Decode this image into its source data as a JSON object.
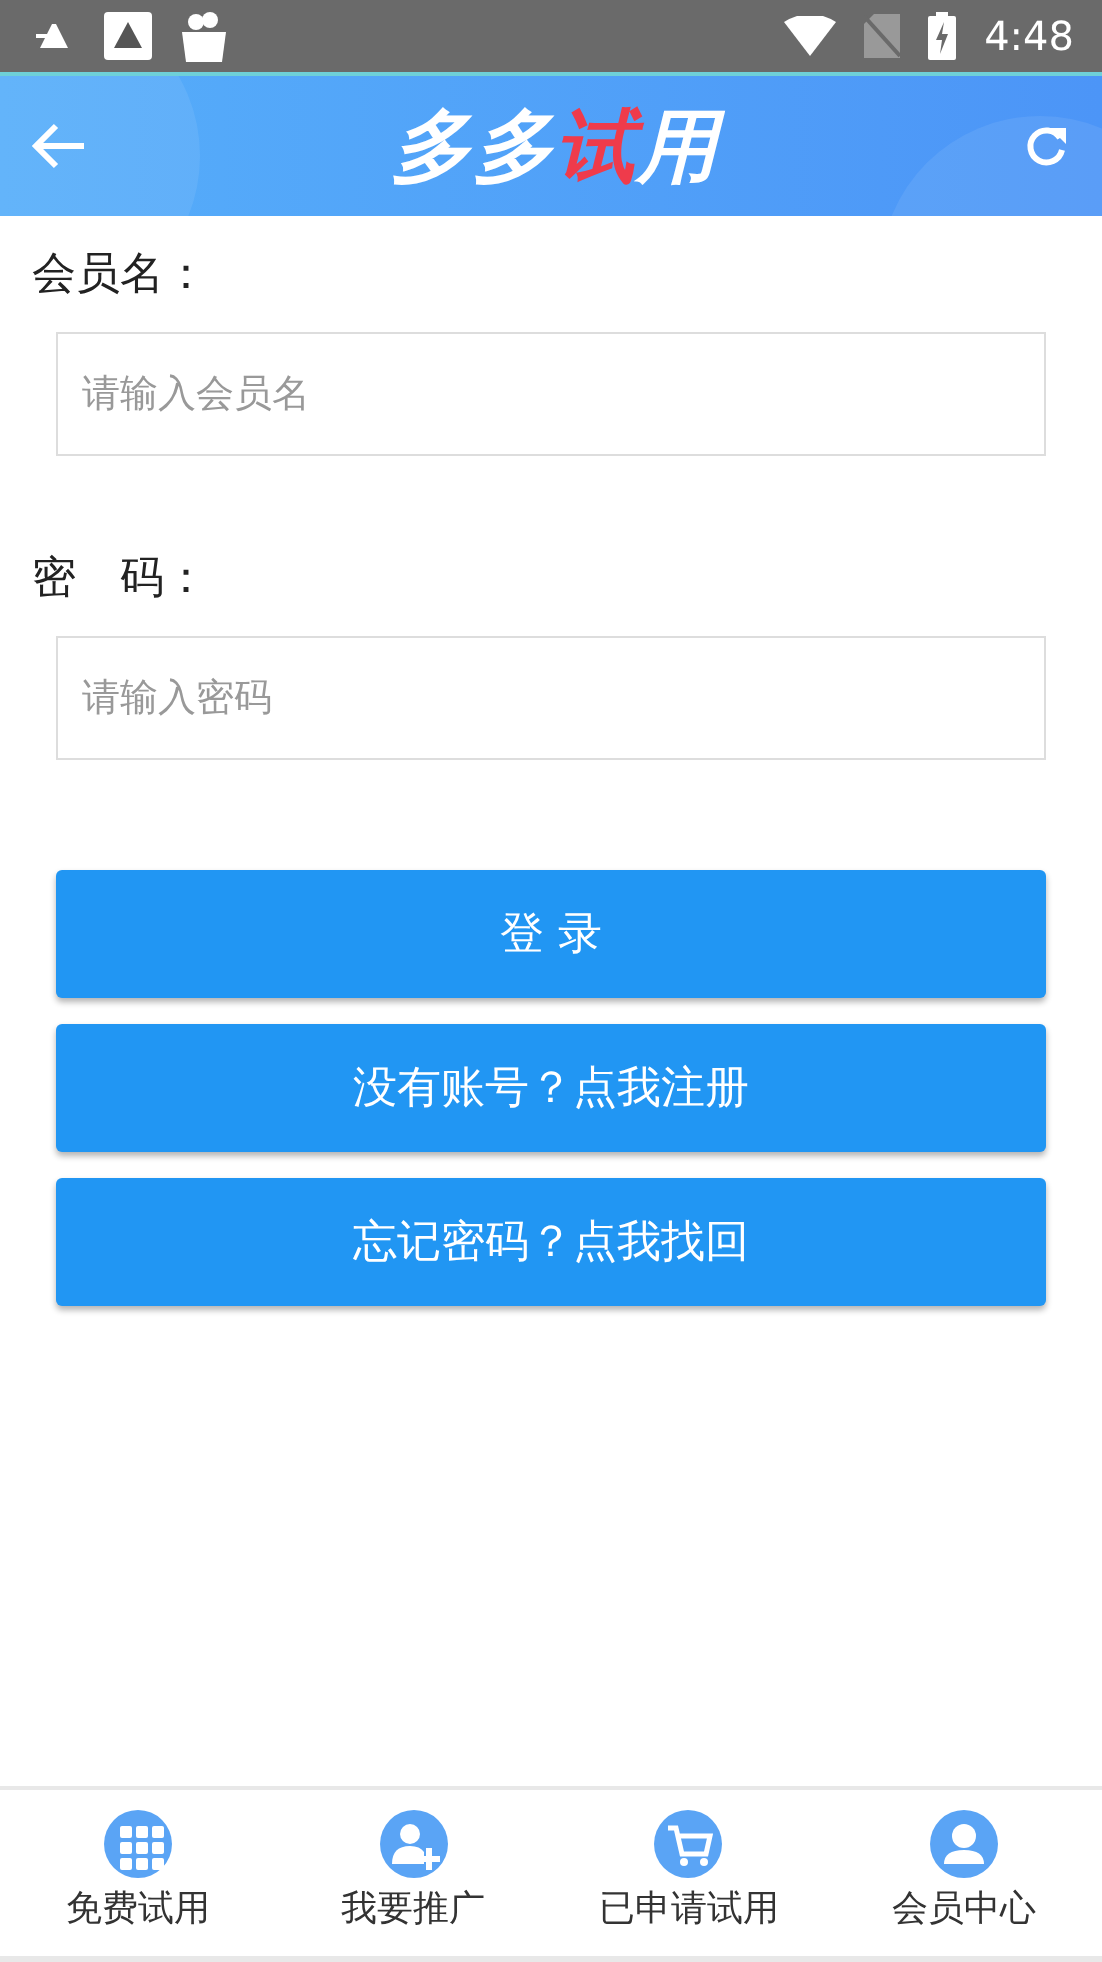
{
  "status_bar": {
    "time": "4:48"
  },
  "header": {
    "logo": [
      {
        "text": "多多",
        "accent": false
      },
      {
        "text": "试",
        "accent": true
      },
      {
        "text": "用",
        "accent": false
      }
    ]
  },
  "form": {
    "fields": [
      {
        "label": "会员名：",
        "placeholder": "请输入会员名"
      },
      {
        "label": "密　码：",
        "placeholder": "请输入密码"
      }
    ],
    "buttons": [
      "登 录",
      "没有账号？点我注册",
      "忘记密码？点我找回"
    ]
  },
  "bottom_nav": [
    {
      "label": "免费试用",
      "kind": "grid"
    },
    {
      "label": "我要推广",
      "kind": "add-user"
    },
    {
      "label": "已申请试用",
      "kind": "cart"
    },
    {
      "label": "会员中心",
      "kind": "user"
    }
  ]
}
